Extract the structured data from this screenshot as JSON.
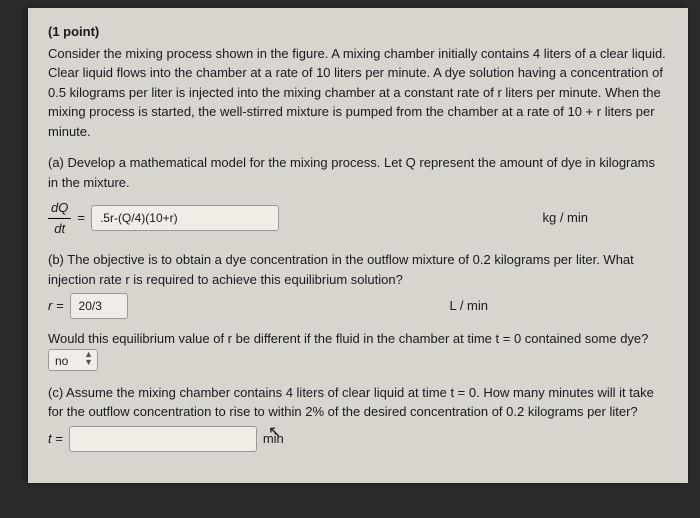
{
  "points": "(1 point)",
  "problem_text": "Consider the mixing process shown in the figure. A mixing chamber initially contains 4 liters of a clear liquid. Clear liquid flows into the chamber at a rate of 10 liters per minute. A dye solution having a concentration of 0.5 kilograms per liter is injected into the mixing chamber at a constant rate of r liters per minute. When the mixing process is started, the well-stirred mixture is pumped from the chamber at a rate of 10 + r liters per minute.",
  "parts": {
    "a": {
      "text": "(a) Develop a mathematical model for the mixing process. Let Q represent the amount of dye in kilograms in the mixture.",
      "frac_num": "dQ",
      "frac_den": "dt",
      "equals": "=",
      "input": ".5r-(Q/4)(10+r)",
      "unit": "kg / min"
    },
    "b": {
      "text": "(b) The objective is to obtain a dye concentration in the outflow mixture of 0.2 kilograms per liter. What injection rate r is required to achieve this equilibrium solution?",
      "label": "r =",
      "input": "20/3",
      "unit": "L / min",
      "question2": "Would this equilibrium value of r be different if the fluid in the chamber at time t = 0 contained some dye?",
      "select": "no"
    },
    "c": {
      "text": "(c) Assume the mixing chamber contains 4 liters of clear liquid at time t = 0. How many minutes will it take for the outflow concentration to rise to within 2% of the desired concentration of 0.2 kilograms per liter?",
      "label": "t =",
      "input": "",
      "unit": "min"
    }
  }
}
